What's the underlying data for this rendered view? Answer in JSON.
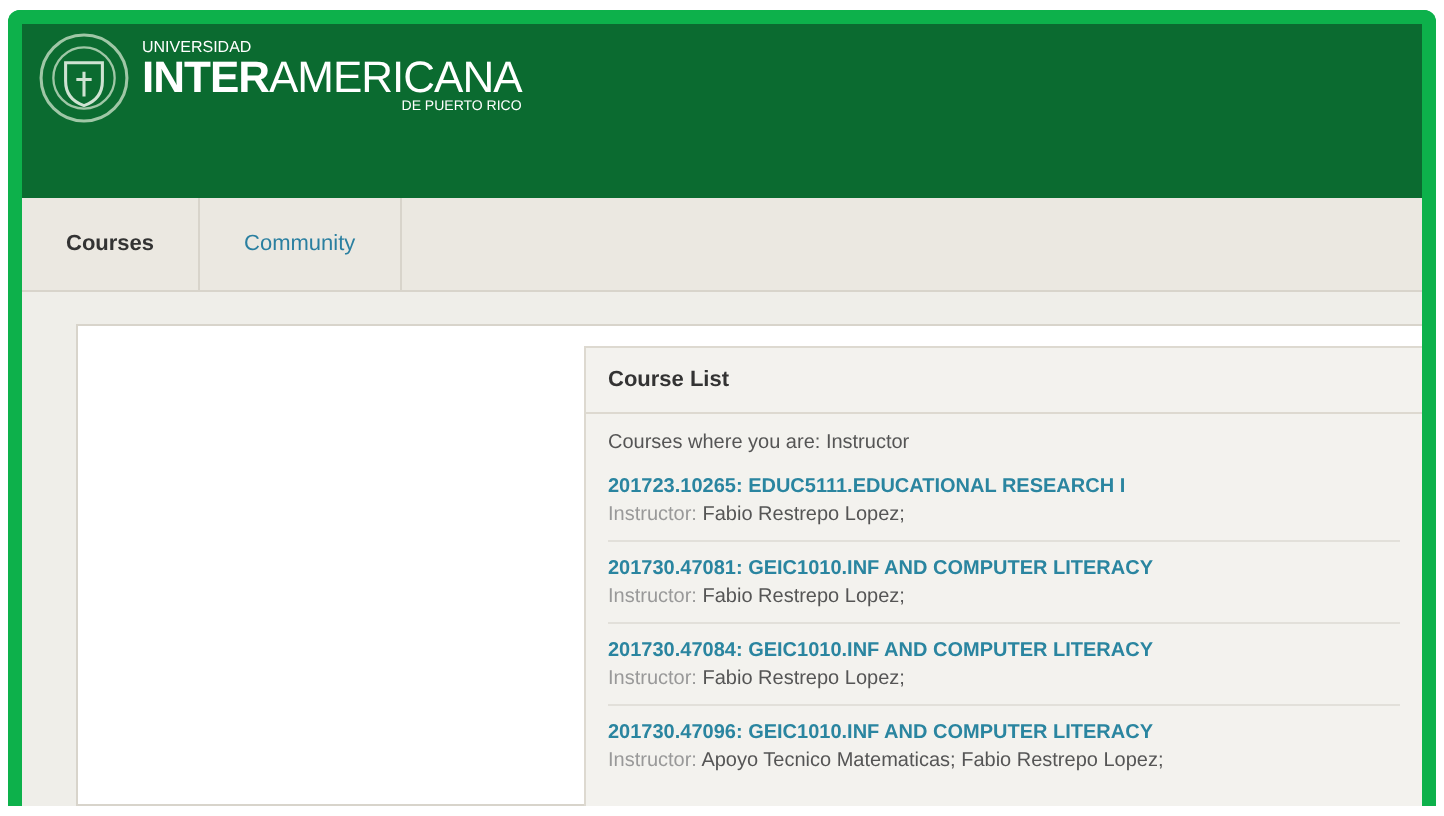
{
  "header": {
    "logo_top": "UNIVERSIDAD",
    "logo_main": "**INTER**AMERICANA",
    "logo_sub": "DE PUERTO RICO"
  },
  "tabs": [
    {
      "label": "Courses",
      "selected": true
    },
    {
      "label": "Community",
      "selected": false
    }
  ],
  "course_list": {
    "title": "Course List",
    "intro": "Courses where you are: Instructor",
    "courses": [
      {
        "title": "201723.10265: EDUC5111.EDUCATIONAL RESEARCH I",
        "role": "Instructor:",
        "people": "Fabio Restrepo Lopez;"
      },
      {
        "title": "201730.47081: GEIC1010.INF AND COMPUTER LITERACY",
        "role": "Instructor:",
        "people": "Fabio Restrepo Lopez;"
      },
      {
        "title": "201730.47084: GEIC1010.INF AND COMPUTER LITERACY",
        "role": "Instructor:",
        "people": "Fabio Restrepo Lopez;"
      },
      {
        "title": "201730.47096: GEIC1010.INF AND COMPUTER LITERACY",
        "role": "Instructor:",
        "people": "Apoyo Tecnico Matematicas;  Fabio Restrepo Lopez;"
      }
    ]
  }
}
